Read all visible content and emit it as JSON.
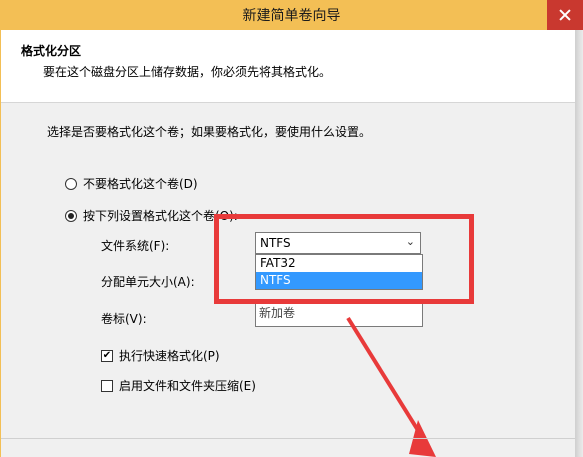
{
  "window": {
    "title": "新建简单卷向导"
  },
  "header": {
    "title": "格式化分区",
    "subtitle": "要在这个磁盘分区上储存数据，你必须先将其格式化。"
  },
  "main": {
    "instruction": "选择是否要格式化这个卷；如果要格式化，要使用什么设置。",
    "radio_no_format": {
      "label": "不要格式化这个卷(D)",
      "checked": false
    },
    "radio_format": {
      "label": "按下列设置格式化这个卷(O):",
      "checked": true
    },
    "file_system": {
      "label": "文件系统(F):",
      "value": "NTFS",
      "options": [
        "FAT32",
        "NTFS"
      ],
      "highlighted": "NTFS"
    },
    "allocation_unit": {
      "label": "分配单元大小(A):"
    },
    "volume_label": {
      "label": "卷标(V):",
      "value": "新加卷"
    },
    "quick_format": {
      "label": "执行快速格式化(P)",
      "checked": true,
      "mark": "✔"
    },
    "compression": {
      "label": "启用文件和文件夹压缩(E)",
      "checked": false
    }
  },
  "colors": {
    "title_bar": "#f3bf55",
    "annotation_red": "#e83a3a",
    "selection_blue": "#3399ff"
  }
}
